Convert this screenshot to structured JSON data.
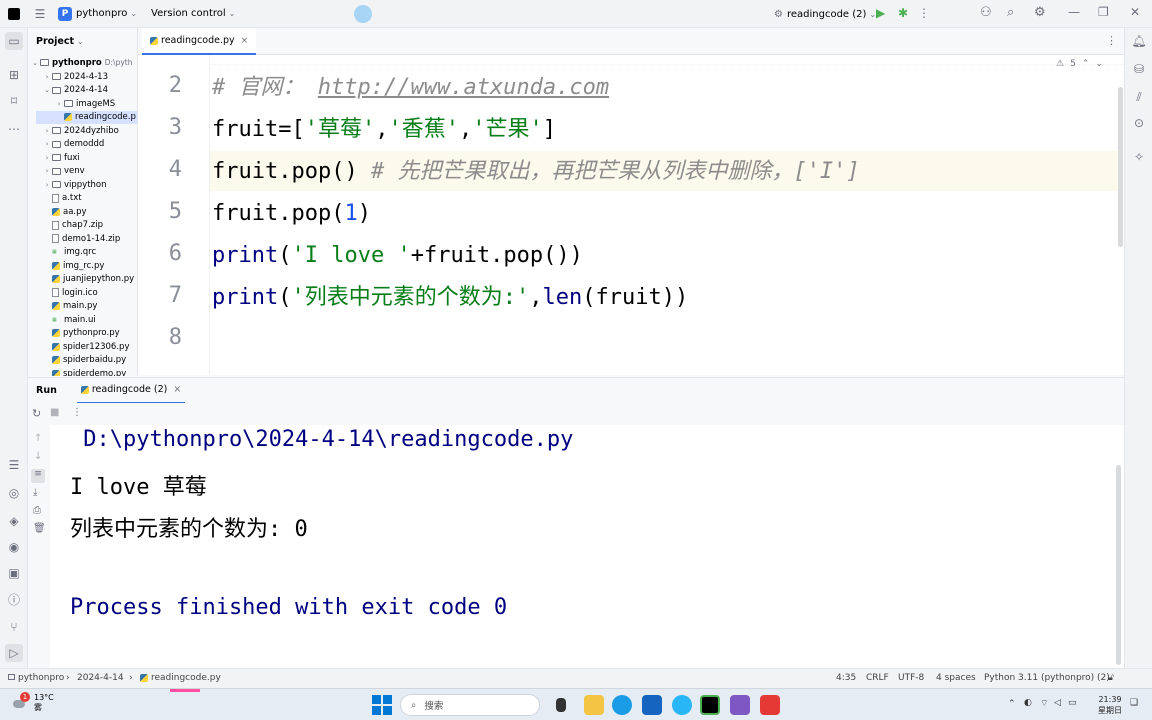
{
  "titlebar": {
    "project_badge": "P",
    "project_name": "pythonpro",
    "vcs": "Version control",
    "run_config": "readingcode (2)"
  },
  "project_panel": {
    "title": "Project",
    "root": "pythonpro",
    "root_path": "D:\\pyth",
    "items": [
      {
        "label": "2024-4-13",
        "type": "folder",
        "depth": 1,
        "arrow": "›"
      },
      {
        "label": "2024-4-14",
        "type": "folder",
        "depth": 1,
        "arrow": "⌄"
      },
      {
        "label": "imageMS",
        "type": "folder",
        "depth": 2,
        "arrow": "›"
      },
      {
        "label": "readingcode.p",
        "type": "py",
        "depth": 2,
        "arrow": ""
      },
      {
        "label": "2024dyzhibo",
        "type": "folder",
        "depth": 1,
        "arrow": "›"
      },
      {
        "label": "demoddd",
        "type": "folder",
        "depth": 1,
        "arrow": "›"
      },
      {
        "label": "fuxi",
        "type": "folder",
        "depth": 1,
        "arrow": "›"
      },
      {
        "label": "venv",
        "type": "folder",
        "depth": 1,
        "arrow": "›"
      },
      {
        "label": "vippython",
        "type": "folder",
        "depth": 1,
        "arrow": "›"
      },
      {
        "label": "a.txt",
        "type": "file",
        "depth": 1,
        "arrow": ""
      },
      {
        "label": "aa.py",
        "type": "py",
        "depth": 1,
        "arrow": ""
      },
      {
        "label": "chap7.zip",
        "type": "file",
        "depth": 1,
        "arrow": ""
      },
      {
        "label": "demo1-14.zip",
        "type": "file",
        "depth": 1,
        "arrow": ""
      },
      {
        "label": "img.qrc",
        "type": "qrc",
        "depth": 1,
        "arrow": ""
      },
      {
        "label": "img_rc.py",
        "type": "py",
        "depth": 1,
        "arrow": ""
      },
      {
        "label": "juanjiepython.py",
        "type": "py",
        "depth": 1,
        "arrow": ""
      },
      {
        "label": "login.ico",
        "type": "file",
        "depth": 1,
        "arrow": ""
      },
      {
        "label": "main.py",
        "type": "py",
        "depth": 1,
        "arrow": ""
      },
      {
        "label": "main.ui",
        "type": "qrc",
        "depth": 1,
        "arrow": ""
      },
      {
        "label": "pythonpro.py",
        "type": "py",
        "depth": 1,
        "arrow": ""
      },
      {
        "label": "spider12306.py",
        "type": "py",
        "depth": 1,
        "arrow": ""
      },
      {
        "label": "spiderbaidu.py",
        "type": "py",
        "depth": 1,
        "arrow": ""
      },
      {
        "label": "spiderdemo.py",
        "type": "py",
        "depth": 1,
        "arrow": ""
      }
    ]
  },
  "editor": {
    "tab": "readingcode.py",
    "inspections": "5",
    "lines": [
      {
        "n": "2",
        "html": "<span class='cm'># 官网： </span><span class='url'>http://www.atxunda.com</span>"
      },
      {
        "n": "3",
        "html": "fruit=[<span class='str'>'草莓'</span>,<span class='str'>'香蕉'</span>,<span class='str'>'芒果'</span>]"
      },
      {
        "n": "4",
        "html": "fruit.pop() <span class='cm'># 先把芒果取出，再把芒果从列表中删除，['I']</span>"
      },
      {
        "n": "5",
        "html": "fruit.pop(<span class='num'>1</span>)"
      },
      {
        "n": "6",
        "html": "<span class='fn'>print</span>(<span class='str'>'I love '</span>+fruit.pop())"
      },
      {
        "n": "7",
        "html": "<span class='fn'>print</span>(<span class='str'>'列表中元素的个数为:'</span>,<span class='fn'>len</span>(fruit))"
      },
      {
        "n": "8",
        "html": ""
      }
    ]
  },
  "run": {
    "title": "Run",
    "tab": "readingcode (2)",
    "output": [
      {
        "text": " D:\\pythonpro\\2024-4-14\\readingcode.py",
        "cls": "con-blue"
      },
      {
        "text": "I love 草莓",
        "cls": ""
      },
      {
        "text": "列表中元素的个数为: 0",
        "cls": ""
      },
      {
        "text": "",
        "cls": ""
      },
      {
        "text": "Process finished with exit code 0",
        "cls": "con-blue"
      }
    ]
  },
  "statusbar": {
    "crumb1": "pythonpro",
    "crumb2": "2024-4-14",
    "crumb3": "readingcode.py",
    "position": "4:35",
    "line_sep": "CRLF",
    "encoding": "UTF-8",
    "indent": "4 spaces",
    "interpreter": "Python 3.11 (pythonpro) (2)"
  },
  "taskbar": {
    "weather_temp": "13°C",
    "weather_desc": "雾",
    "badge": "1",
    "search": "搜索",
    "time": "21:39",
    "day": "星期日"
  }
}
